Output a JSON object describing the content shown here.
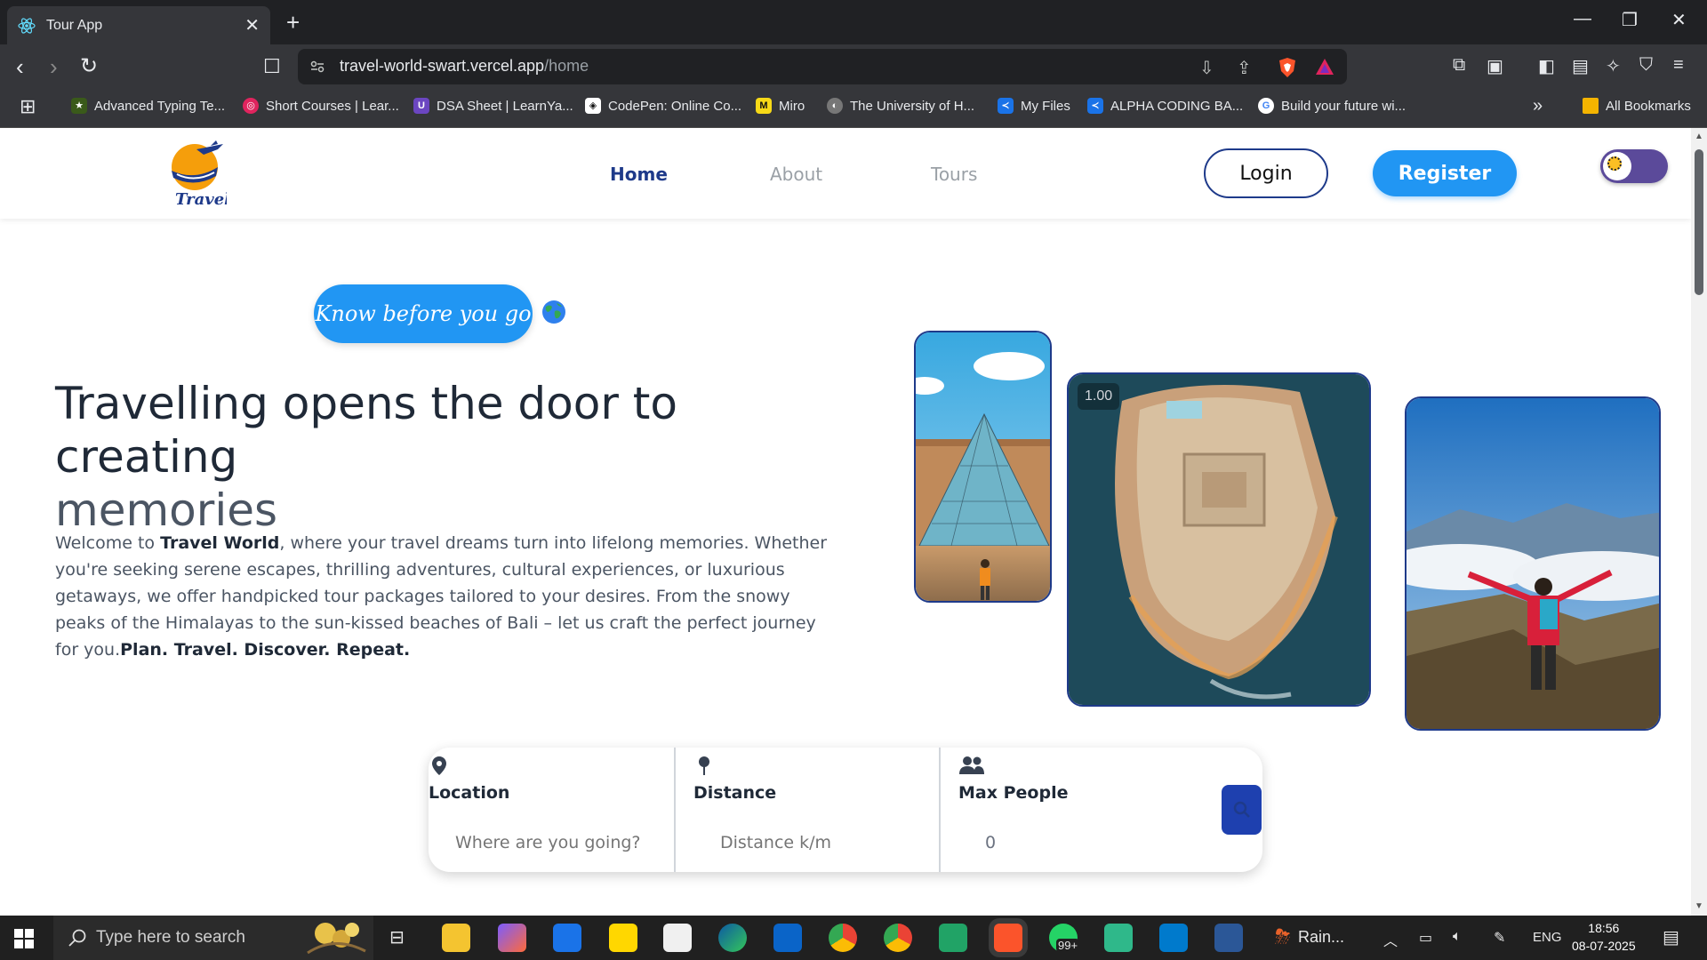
{
  "browser": {
    "tab_title": "Tour App",
    "url_host": "travel-world-swart.vercel.app",
    "url_path": "/home",
    "bookmarks": [
      {
        "label": "Advanced Typing Te...",
        "color": "#3a5a1a"
      },
      {
        "label": "Short Courses | Lear...",
        "color": "#e0245e"
      },
      {
        "label": "DSA Sheet | LearnYa...",
        "color": "#6b46c1"
      },
      {
        "label": "CodePen: Online Co...",
        "color": "#111111"
      },
      {
        "label": "Miro",
        "color": "#f7d917"
      },
      {
        "label": "The University of H...",
        "color": "#555555"
      },
      {
        "label": "My Files",
        "color": "#1a73e8"
      },
      {
        "label": "ALPHA CODING BA...",
        "color": "#1a73e8"
      },
      {
        "label": "Build your future wi...",
        "color": "#ffffff"
      }
    ],
    "all_bookmarks": "All Bookmarks"
  },
  "header": {
    "nav": [
      "Home",
      "About",
      "Tours"
    ],
    "login": "Login",
    "register": "Register"
  },
  "hero": {
    "tagline": "Know before you go",
    "title_line1": "Travelling opens the door to creating",
    "title_line2": "memories",
    "text_start": "Welcome to ",
    "text_brand": "Travel World",
    "text_body": ", where your travel dreams turn into lifelong memories. Whether you're seeking serene escapes, thrilling adventures, cultural experiences, or luxurious getaways, we offer handpicked tour packages tailored to your desires. From the snowy peaks of the Himalayas to the sun-kissed beaches of Bali – let us craft the perfect journey for you.",
    "text_end": "Plan. Travel. Discover. Repeat.",
    "video_counter": "1.00"
  },
  "search": {
    "location_label": "Location",
    "location_placeholder": "Where are you going?",
    "distance_label": "Distance",
    "distance_placeholder": "Distance k/m",
    "people_label": "Max People",
    "people_value": "0"
  },
  "taskbar": {
    "search_text": "Type here to search",
    "weather": "Rain...",
    "language": "ENG",
    "time": "18:56",
    "date": "08-07-2025",
    "badge": "99+"
  },
  "colors": {
    "primary": "#2196f3",
    "dark_blue": "#1e3a8a",
    "heading": "#1f2937"
  }
}
